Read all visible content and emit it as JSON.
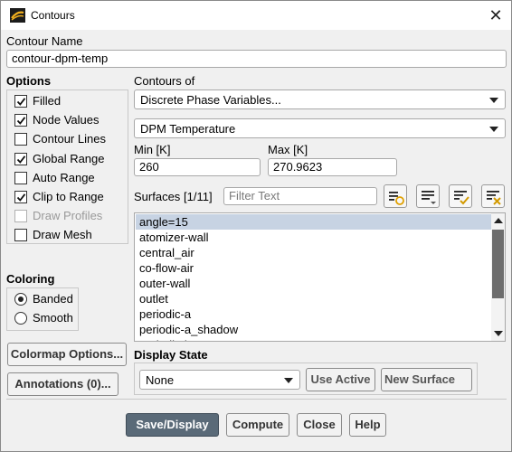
{
  "window": {
    "title": "Contours",
    "icon": "app-logo-icon",
    "close_icon": "close-icon"
  },
  "contour_name": {
    "label": "Contour Name",
    "value": "contour-dpm-temp"
  },
  "options": {
    "label": "Options",
    "items": [
      {
        "label": "Filled",
        "checked": true,
        "disabled": false
      },
      {
        "label": "Node Values",
        "checked": true,
        "disabled": false
      },
      {
        "label": "Contour Lines",
        "checked": false,
        "disabled": false
      },
      {
        "label": "Global Range",
        "checked": true,
        "disabled": false
      },
      {
        "label": "Auto Range",
        "checked": false,
        "disabled": false
      },
      {
        "label": "Clip to Range",
        "checked": true,
        "disabled": false
      },
      {
        "label": "Draw Profiles",
        "checked": false,
        "disabled": true
      },
      {
        "label": "Draw Mesh",
        "checked": false,
        "disabled": false
      }
    ]
  },
  "coloring": {
    "label": "Coloring",
    "options": [
      {
        "label": "Banded",
        "selected": true
      },
      {
        "label": "Smooth",
        "selected": false
      }
    ]
  },
  "contours_of": {
    "label": "Contours of",
    "category": "Discrete Phase Variables...",
    "variable": "DPM Temperature"
  },
  "range": {
    "min_label": "Min [K]",
    "min_value": "260",
    "max_label": "Max [K]",
    "max_value": "270.9623"
  },
  "surfaces": {
    "label": "Surfaces",
    "count": "[1/11]",
    "filter_placeholder": "Filter Text",
    "items": [
      {
        "label": "angle=15",
        "selected": true
      },
      {
        "label": "atomizer-wall",
        "selected": false
      },
      {
        "label": "central_air",
        "selected": false
      },
      {
        "label": "co-flow-air",
        "selected": false
      },
      {
        "label": "outer-wall",
        "selected": false
      },
      {
        "label": "outlet",
        "selected": false
      },
      {
        "label": "periodic-a",
        "selected": false
      },
      {
        "label": "periodic-a_shadow",
        "selected": false
      },
      {
        "label": "periodic-b",
        "selected": false
      }
    ],
    "toolbar_icons": [
      "select-surface-icon",
      "list-options-icon",
      "select-all-icon",
      "deselect-all-icon"
    ]
  },
  "side_buttons": {
    "colormap": "Colormap Options...",
    "annotations": "Annotations (0)..."
  },
  "display_state": {
    "label": "Display State",
    "value": "None",
    "use_active": "Use Active",
    "new_surface": "New Surface"
  },
  "footer": {
    "save_display": "Save/Display",
    "compute": "Compute",
    "close": "Close",
    "help": "Help"
  }
}
